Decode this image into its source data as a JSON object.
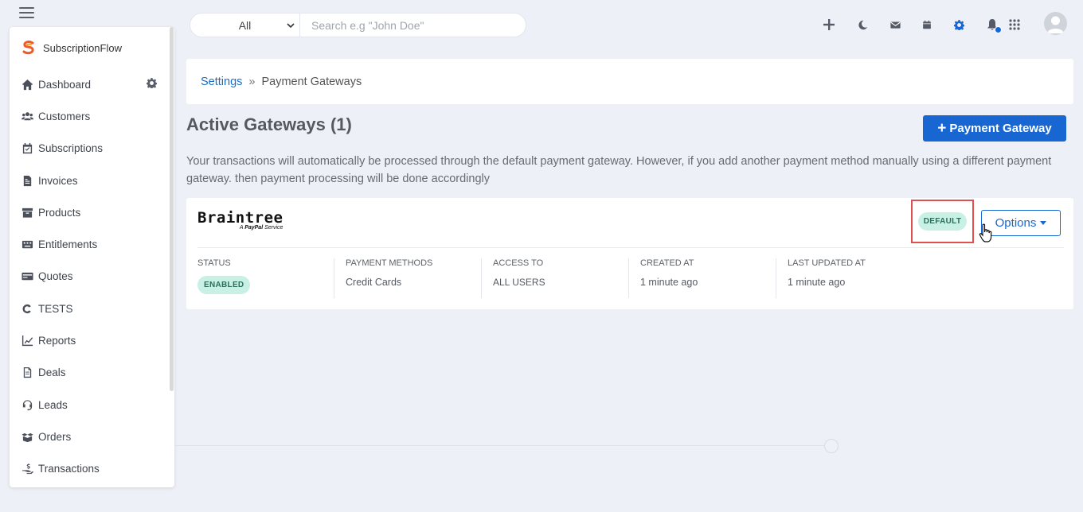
{
  "brand": {
    "name": "SubscriptionFlow"
  },
  "sidebar": {
    "items": [
      {
        "label": "Dashboard",
        "icon": "home-icon"
      },
      {
        "label": "Customers",
        "icon": "users-icon"
      },
      {
        "label": "Subscriptions",
        "icon": "calendar-check-icon"
      },
      {
        "label": "Invoices",
        "icon": "invoice-icon"
      },
      {
        "label": "Products",
        "icon": "archive-icon"
      },
      {
        "label": "Entitlements",
        "icon": "keyboard-icon"
      },
      {
        "label": "Quotes",
        "icon": "quote-card-icon"
      },
      {
        "label": "TESTS",
        "icon": "c-logo-icon"
      },
      {
        "label": "Reports",
        "icon": "chart-line-icon"
      },
      {
        "label": "Deals",
        "icon": "file-icon"
      },
      {
        "label": "Leads",
        "icon": "headset-icon"
      },
      {
        "label": "Orders",
        "icon": "boxes-icon"
      },
      {
        "label": "Transactions",
        "icon": "hand-dollar-icon"
      }
    ]
  },
  "search": {
    "scope": "All",
    "placeholder": "Search e.g \"John Doe\""
  },
  "breadcrumb": {
    "parent": "Settings",
    "separator": "»",
    "current": "Payment Gateways"
  },
  "page": {
    "title": "Active Gateways (1)",
    "add_button": "Payment Gateway",
    "description": "Your transactions will automatically be processed through the default payment gateway. However, if you add another payment method manually using a different payment gateway. then payment processing will be done accordingly"
  },
  "gateway": {
    "logo_name": "Braintree",
    "logo_tagline_prefix": "A",
    "logo_tagline_brand": "PayPal",
    "logo_tagline_suffix": "Service",
    "default_badge": "DEFAULT",
    "options_label": "Options",
    "columns": [
      {
        "label": "STATUS",
        "value": "ENABLED"
      },
      {
        "label": "PAYMENT METHODS",
        "value": "Credit Cards"
      },
      {
        "label": "ACCESS TO",
        "value": "ALL USERS"
      },
      {
        "label": "CREATED AT",
        "value": "1 minute ago"
      },
      {
        "label": "LAST UPDATED AT",
        "value": "1 minute ago"
      }
    ]
  },
  "colors": {
    "accent": "#1766d1",
    "badge_bg": "#c8f0e4",
    "highlight_border": "#e05050",
    "background": "#edf0f6"
  }
}
